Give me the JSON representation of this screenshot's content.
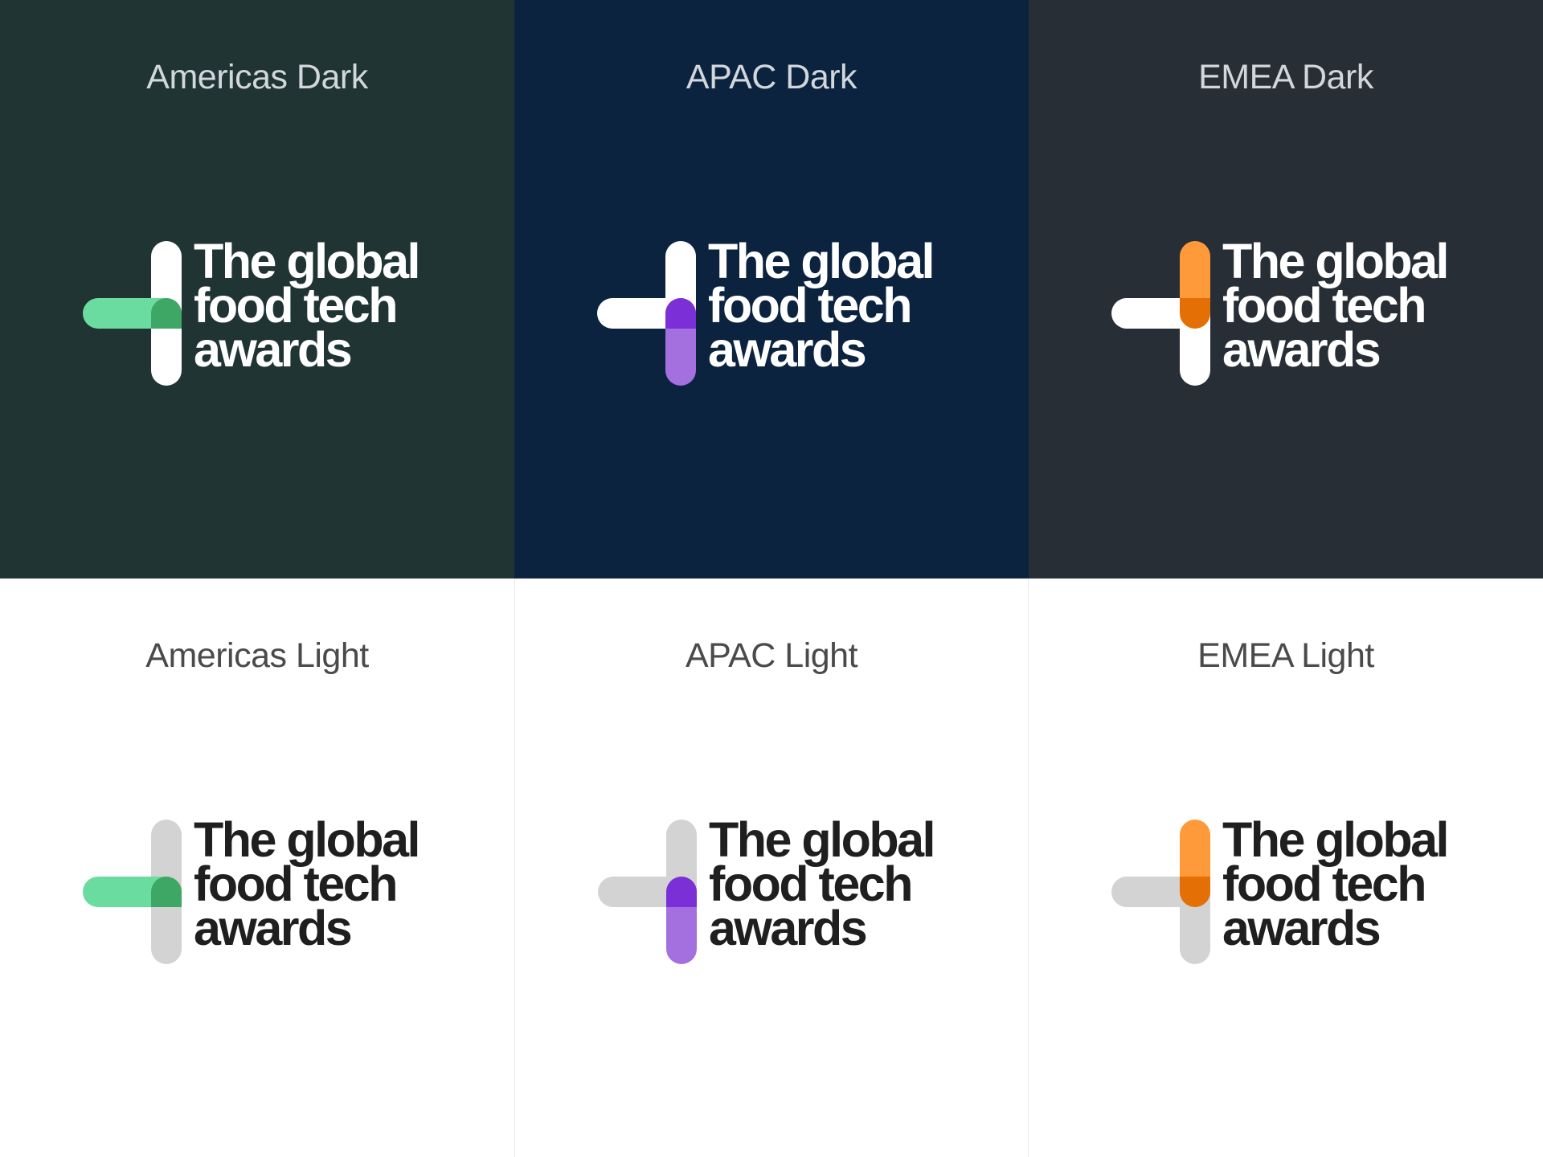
{
  "colors": {
    "americas_dark_bg": "#1f3433",
    "apac_dark_bg": "#0c2340",
    "emea_dark_bg": "#282e36",
    "light_bg": "#ffffff",
    "mark_white": "#ffffff",
    "mark_grey": "#d3d3d3",
    "americas_accent": "#6bdc9f",
    "americas_overlap": "#3fa766",
    "apac_accent": "#a470e0",
    "apac_overlap": "#7b2fd6",
    "emea_accent": "#ff9a3b",
    "emea_overlap": "#e36f05"
  },
  "logo": {
    "line1": "The global",
    "line2": "food tech",
    "line3": "awards"
  },
  "tiles": [
    {
      "label": "Americas Dark",
      "theme": "dark",
      "accent_part": "horizontal-bar"
    },
    {
      "label": "APAC Dark",
      "theme": "dark",
      "accent_part": "vertical-bar-bottom"
    },
    {
      "label": "EMEA Dark",
      "theme": "dark",
      "accent_part": "vertical-bar-top"
    },
    {
      "label": "Americas Light",
      "theme": "light",
      "accent_part": "horizontal-bar"
    },
    {
      "label": "APAC Light",
      "theme": "light",
      "accent_part": "vertical-bar-bottom"
    },
    {
      "label": "EMEA Light",
      "theme": "light",
      "accent_part": "vertical-bar-top"
    }
  ]
}
